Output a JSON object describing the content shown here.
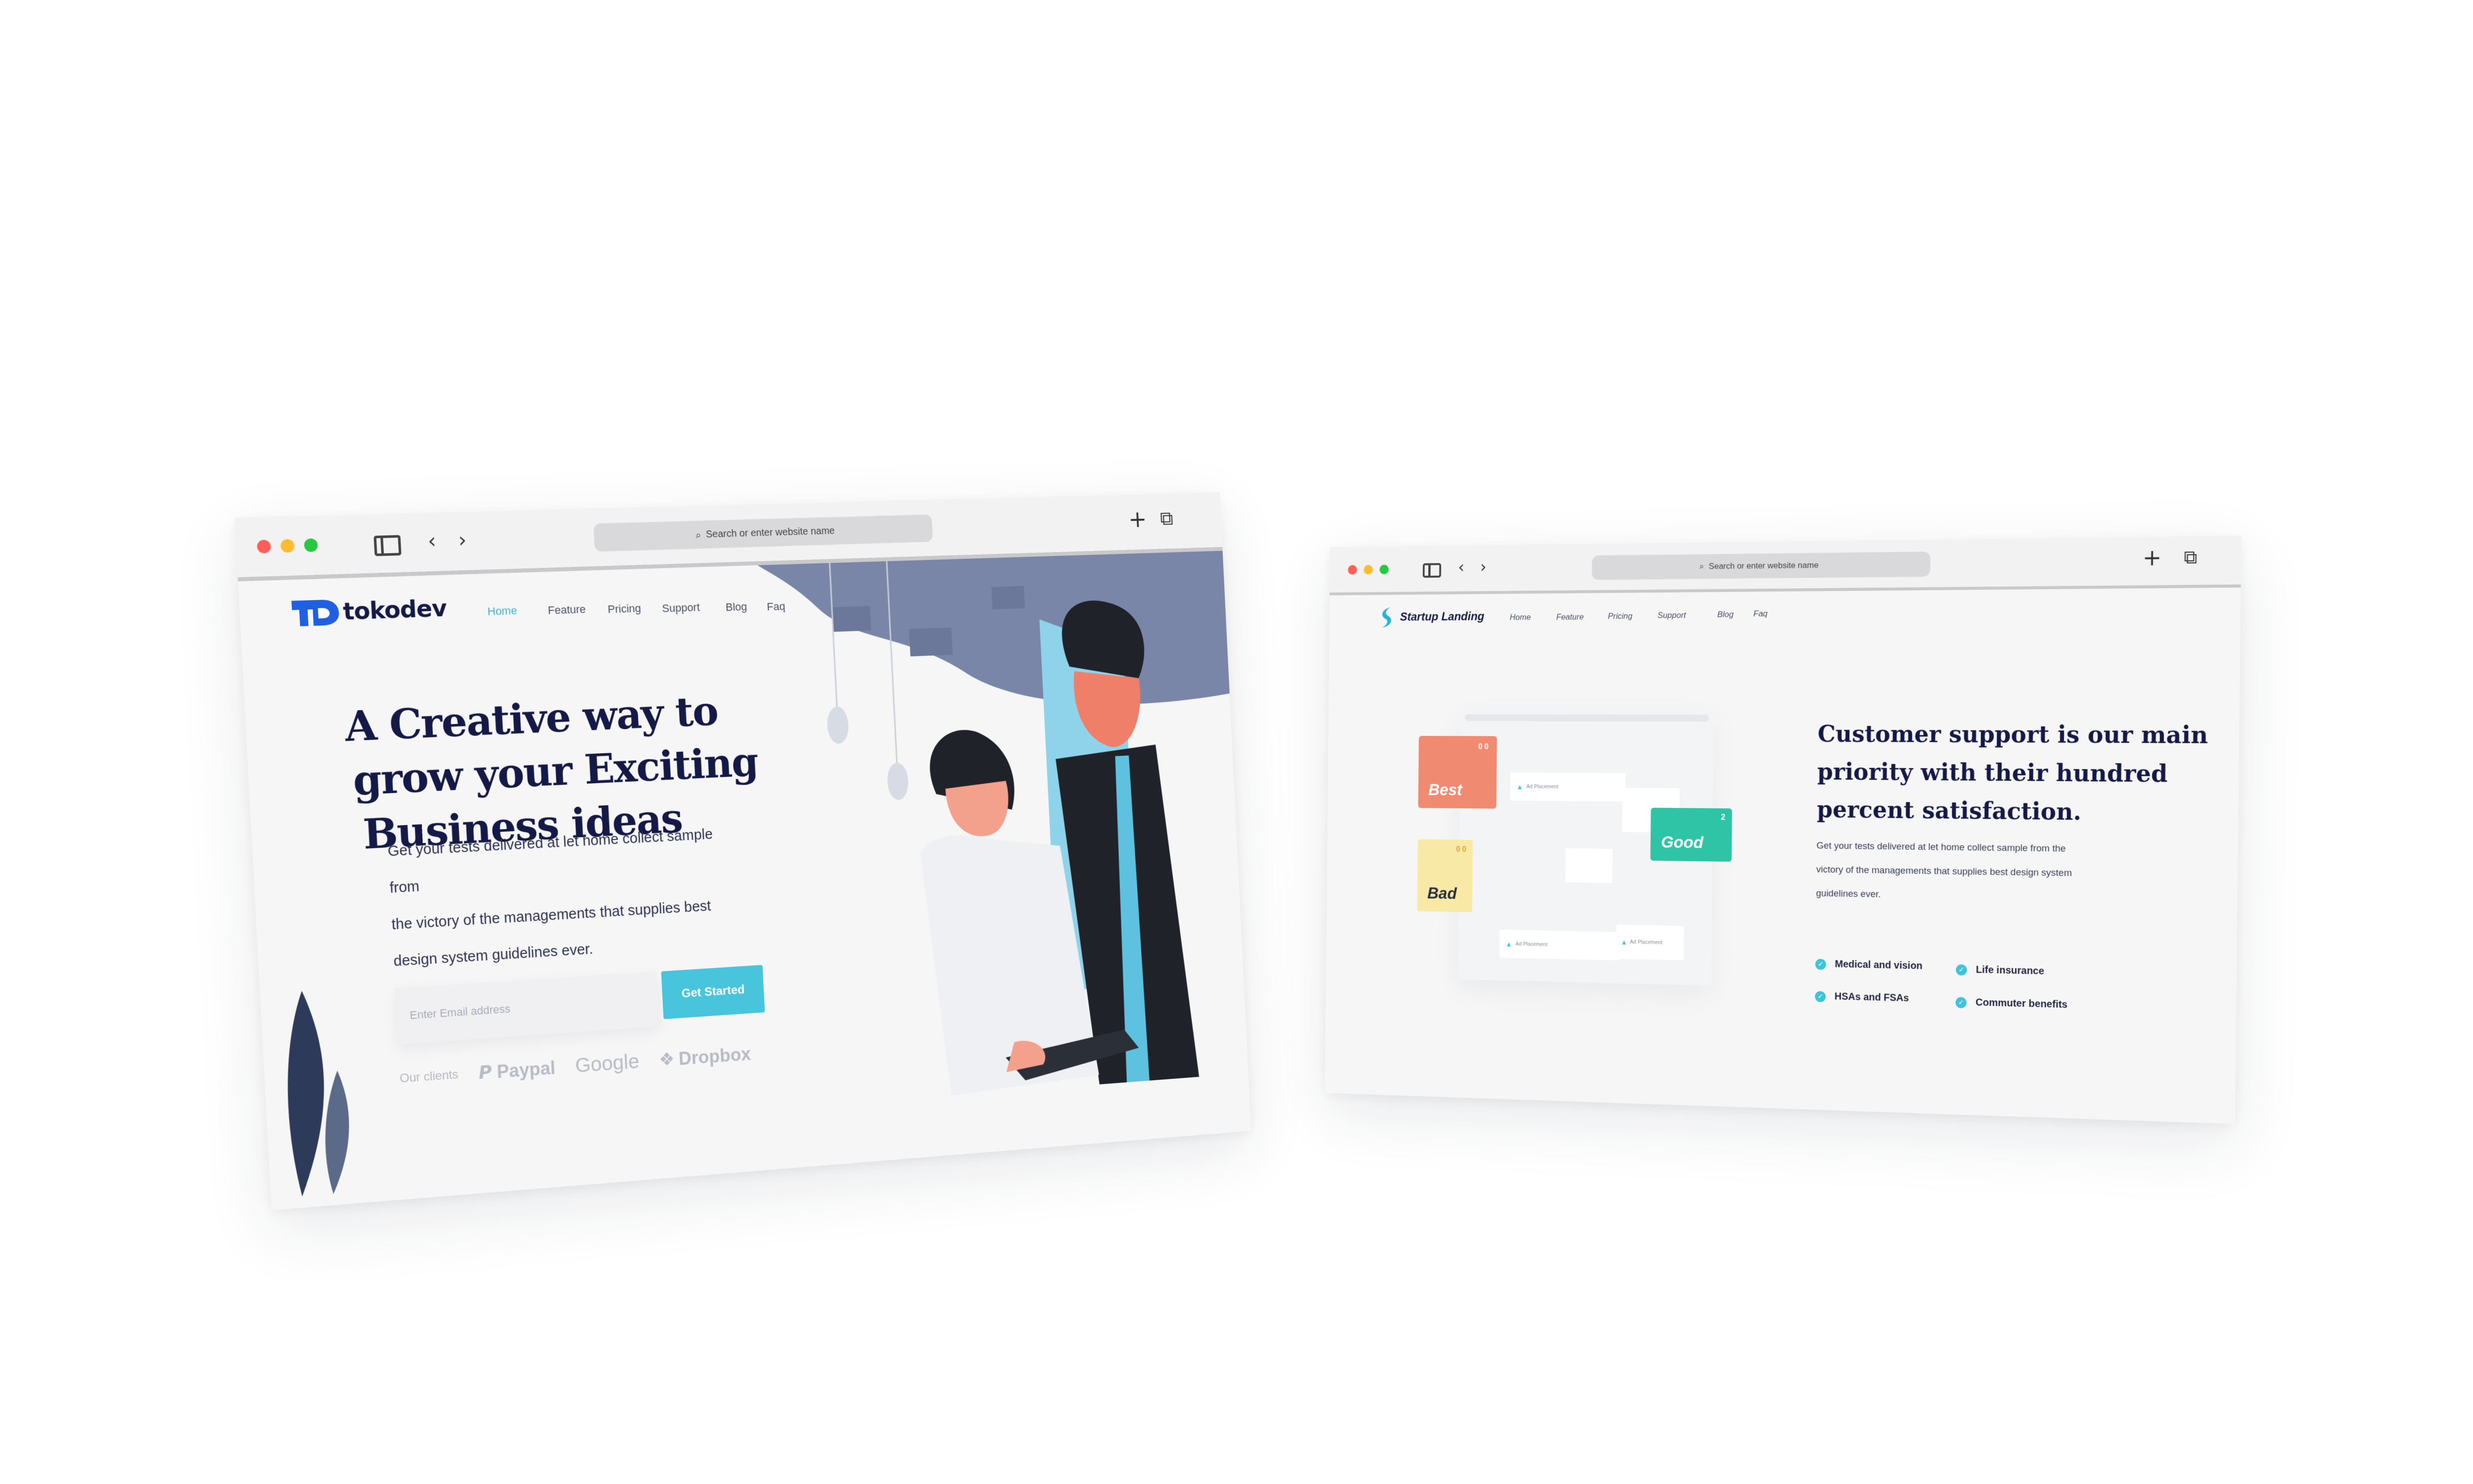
{
  "browser": {
    "url_placeholder": "Search or enter website name",
    "traffic_colors": {
      "close": "#ff5f57",
      "minimize": "#febc2e",
      "zoom": "#28c840"
    }
  },
  "tokodev": {
    "brand": "tokodev",
    "brand_color": "#1f5fe0",
    "nav": [
      "Home",
      "Feature",
      "Pricing",
      "Support",
      "Blog",
      "Faq"
    ],
    "hero_title_lines": [
      "A Creative way to",
      "grow your Exciting",
      "Business ideas"
    ],
    "hero_desc_lines": [
      "Get your tests delivered at let home collect sample from",
      "the victory of the managements that supplies best",
      "design system guidelines ever."
    ],
    "email_placeholder": "Enter Email address",
    "cta": "Get Started",
    "clients_label": "Our clients",
    "clients": [
      "Paypal",
      "Google",
      "Dropbox"
    ],
    "accent": "#48c4dd",
    "title_color": "#141a45"
  },
  "startup": {
    "brand": "Startup Landing",
    "nav": [
      "Home",
      "Feature",
      "Pricing",
      "Support",
      "Blog",
      "Faq"
    ],
    "heading_lines": [
      "Customer support is our main",
      "priority with their hundred",
      "percent satisfaction."
    ],
    "desc_lines": [
      "Get your tests delivered at let home collect sample from the",
      "victory of the managements that supplies best design system",
      "guidelines ever."
    ],
    "features": [
      "Medical and vision",
      "Life insurance",
      "HSAs and FSAs",
      "Commuter benefits"
    ],
    "cards": [
      {
        "label": "Best",
        "color": "#f08b72",
        "badge": "0 0"
      },
      {
        "label": "Good",
        "color": "#2ec4a5",
        "badge": "2"
      },
      {
        "label": "Bad",
        "color": "#f8e9a6",
        "badge": "0 0"
      }
    ],
    "mock_item_label": "Ad Placement",
    "accent": "#3ec3d8"
  }
}
